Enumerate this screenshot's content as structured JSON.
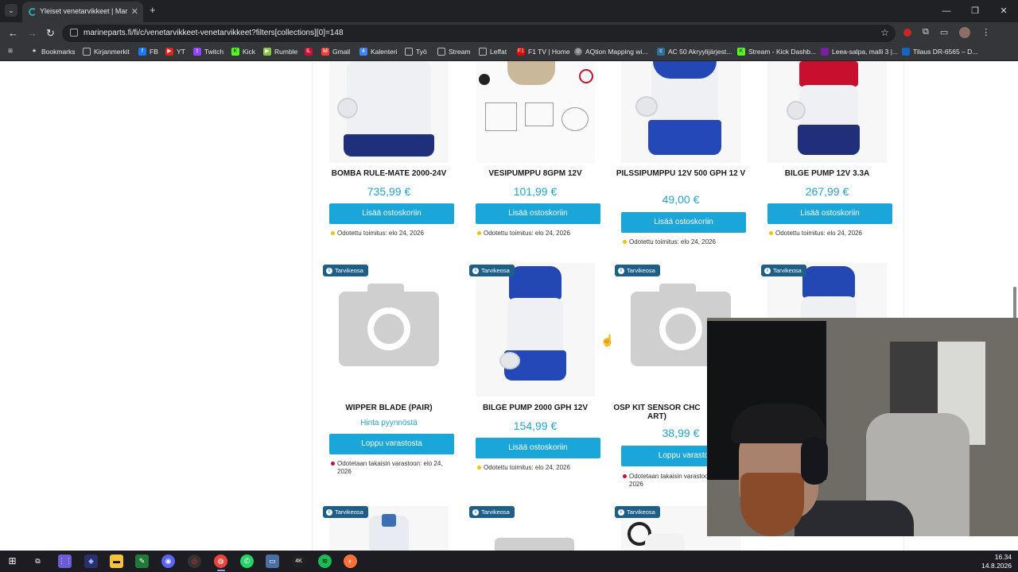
{
  "browser": {
    "tab_title": "Yleiset venetarvikkeet | Marinep",
    "url": "marineparts.fi/fi/c/venetarvikkeet-venetarvikkeet?filters[collections][0]=148",
    "bookmarks": [
      "Bookmarks",
      "Kirjanmerkit",
      "FB",
      "YT",
      "Twitch",
      "Kick",
      "Rumble",
      "Gmail",
      "Kalenteri",
      "Työ",
      "Stream",
      "Leffat",
      "F1 TV | Home",
      "AQtion Mapping wi...",
      "AC 50 Akryylijärjest...",
      "Stream - Kick Dashb...",
      "Leea-salpa, malli 3 |...",
      "Tilaus DR-6565 – D..."
    ]
  },
  "products_row1": [
    {
      "name": "BOMBA RULE-MATE 2000-24V",
      "price": "735,99 €",
      "button": "Lisää ostoskoriin",
      "stock": "Odotettu toimitus: elo 24, 2026"
    },
    {
      "name": "VESIPUMPPU 8GPM 12V",
      "price": "101,99 €",
      "button": "Lisää ostoskoriin",
      "stock": "Odotettu toimitus: elo 24, 2026"
    },
    {
      "name": "PILSSIPUMPPU 12V 500 GPH 12 V",
      "price": "49,00 €",
      "button": "Lisää ostoskoriin",
      "stock": "Odotettu toimitus: elo 24, 2026"
    },
    {
      "name": "BILGE PUMP 12V 3.3A",
      "price": "267,99 €",
      "button": "Lisää ostoskoriin",
      "stock": "Odotettu toimitus: elo 24, 2026"
    }
  ],
  "products_row2": [
    {
      "badge": "Tarvikeosa",
      "name": "WIPPER BLADE (PAIR)",
      "price": "Hinta pyynnöstä",
      "button": "Loppu varastosta",
      "stock": "Odotetaan takaisin varastoon: elo 24, 2026"
    },
    {
      "badge": "Tarvikeosa",
      "name": "BILGE PUMP 2000 GPH 12V",
      "price": "154,99 €",
      "button": "Lisää ostoskoriin",
      "stock": "Odotettu toimitus: elo 24, 2026"
    },
    {
      "badge": "Tarvikeosa",
      "name": "OSP KIT SENSOR CHC ART)",
      "price": "38,99 €",
      "button": "Loppu varasto",
      "stock": "Odotetaan takaisin varastoo 2026"
    },
    {
      "badge": "Tarvikeosa"
    }
  ],
  "products_row3": [
    {
      "badge": "Tarvikeosa"
    },
    {
      "badge": "Tarvikeosa"
    },
    {
      "badge": "Tarvikeosa"
    }
  ],
  "taskbar": {
    "time": "16.34",
    "date": "14.8.2026"
  },
  "colors": {
    "accent": "#1aa6d8",
    "price": "#23a4c9",
    "badge": "#1e5f8a",
    "in_stock_dot": "#f2c200",
    "out_of_stock_dot": "#c8102e"
  }
}
